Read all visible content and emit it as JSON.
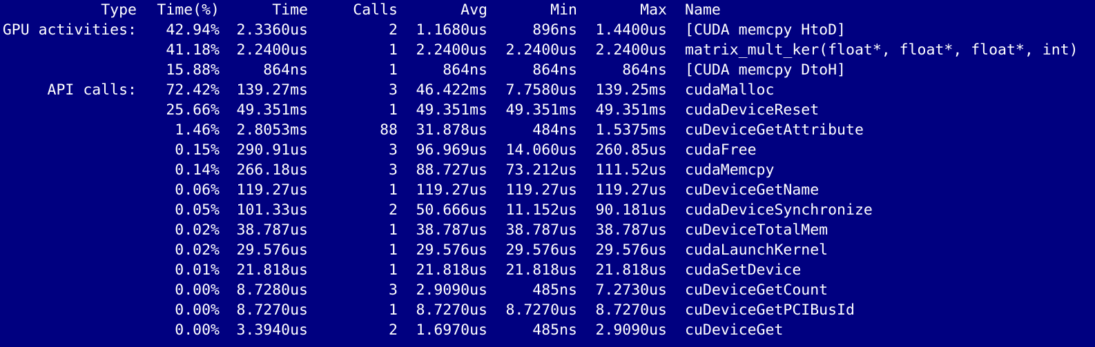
{
  "colors": {
    "background": "#000080",
    "text": "#ffffff"
  },
  "header": {
    "type": "Type",
    "time_pct": "Time(%)",
    "time": "Time",
    "calls": "Calls",
    "avg": "Avg",
    "min": "Min",
    "max": "Max",
    "name": "Name"
  },
  "rows": [
    {
      "type": "GPU activities:",
      "time_pct": "42.94%",
      "time": "2.3360us",
      "calls": "2",
      "avg": "1.1680us",
      "min": "896ns",
      "max": "1.4400us",
      "name": "[CUDA memcpy HtoD]"
    },
    {
      "type": "",
      "time_pct": "41.18%",
      "time": "2.2400us",
      "calls": "1",
      "avg": "2.2400us",
      "min": "2.2400us",
      "max": "2.2400us",
      "name": "matrix_mult_ker(float*, float*, float*, int)"
    },
    {
      "type": "",
      "time_pct": "15.88%",
      "time": "864ns",
      "calls": "1",
      "avg": "864ns",
      "min": "864ns",
      "max": "864ns",
      "name": "[CUDA memcpy DtoH]"
    },
    {
      "type": "API calls:",
      "time_pct": "72.42%",
      "time": "139.27ms",
      "calls": "3",
      "avg": "46.422ms",
      "min": "7.7580us",
      "max": "139.25ms",
      "name": "cudaMalloc"
    },
    {
      "type": "",
      "time_pct": "25.66%",
      "time": "49.351ms",
      "calls": "1",
      "avg": "49.351ms",
      "min": "49.351ms",
      "max": "49.351ms",
      "name": "cudaDeviceReset"
    },
    {
      "type": "",
      "time_pct": "1.46%",
      "time": "2.8053ms",
      "calls": "88",
      "avg": "31.878us",
      "min": "484ns",
      "max": "1.5375ms",
      "name": "cuDeviceGetAttribute"
    },
    {
      "type": "",
      "time_pct": "0.15%",
      "time": "290.91us",
      "calls": "3",
      "avg": "96.969us",
      "min": "14.060us",
      "max": "260.85us",
      "name": "cudaFree"
    },
    {
      "type": "",
      "time_pct": "0.14%",
      "time": "266.18us",
      "calls": "3",
      "avg": "88.727us",
      "min": "73.212us",
      "max": "111.52us",
      "name": "cudaMemcpy"
    },
    {
      "type": "",
      "time_pct": "0.06%",
      "time": "119.27us",
      "calls": "1",
      "avg": "119.27us",
      "min": "119.27us",
      "max": "119.27us",
      "name": "cuDeviceGetName"
    },
    {
      "type": "",
      "time_pct": "0.05%",
      "time": "101.33us",
      "calls": "2",
      "avg": "50.666us",
      "min": "11.152us",
      "max": "90.181us",
      "name": "cudaDeviceSynchronize"
    },
    {
      "type": "",
      "time_pct": "0.02%",
      "time": "38.787us",
      "calls": "1",
      "avg": "38.787us",
      "min": "38.787us",
      "max": "38.787us",
      "name": "cuDeviceTotalMem"
    },
    {
      "type": "",
      "time_pct": "0.02%",
      "time": "29.576us",
      "calls": "1",
      "avg": "29.576us",
      "min": "29.576us",
      "max": "29.576us",
      "name": "cudaLaunchKernel"
    },
    {
      "type": "",
      "time_pct": "0.01%",
      "time": "21.818us",
      "calls": "1",
      "avg": "21.818us",
      "min": "21.818us",
      "max": "21.818us",
      "name": "cudaSetDevice"
    },
    {
      "type": "",
      "time_pct": "0.00%",
      "time": "8.7280us",
      "calls": "3",
      "avg": "2.9090us",
      "min": "485ns",
      "max": "7.2730us",
      "name": "cuDeviceGetCount"
    },
    {
      "type": "",
      "time_pct": "0.00%",
      "time": "8.7270us",
      "calls": "1",
      "avg": "8.7270us",
      "min": "8.7270us",
      "max": "8.7270us",
      "name": "cuDeviceGetPCIBusId"
    },
    {
      "type": "",
      "time_pct": "0.00%",
      "time": "3.3940us",
      "calls": "2",
      "avg": "1.6970us",
      "min": "485ns",
      "max": "2.9090us",
      "name": "cuDeviceGet"
    }
  ]
}
